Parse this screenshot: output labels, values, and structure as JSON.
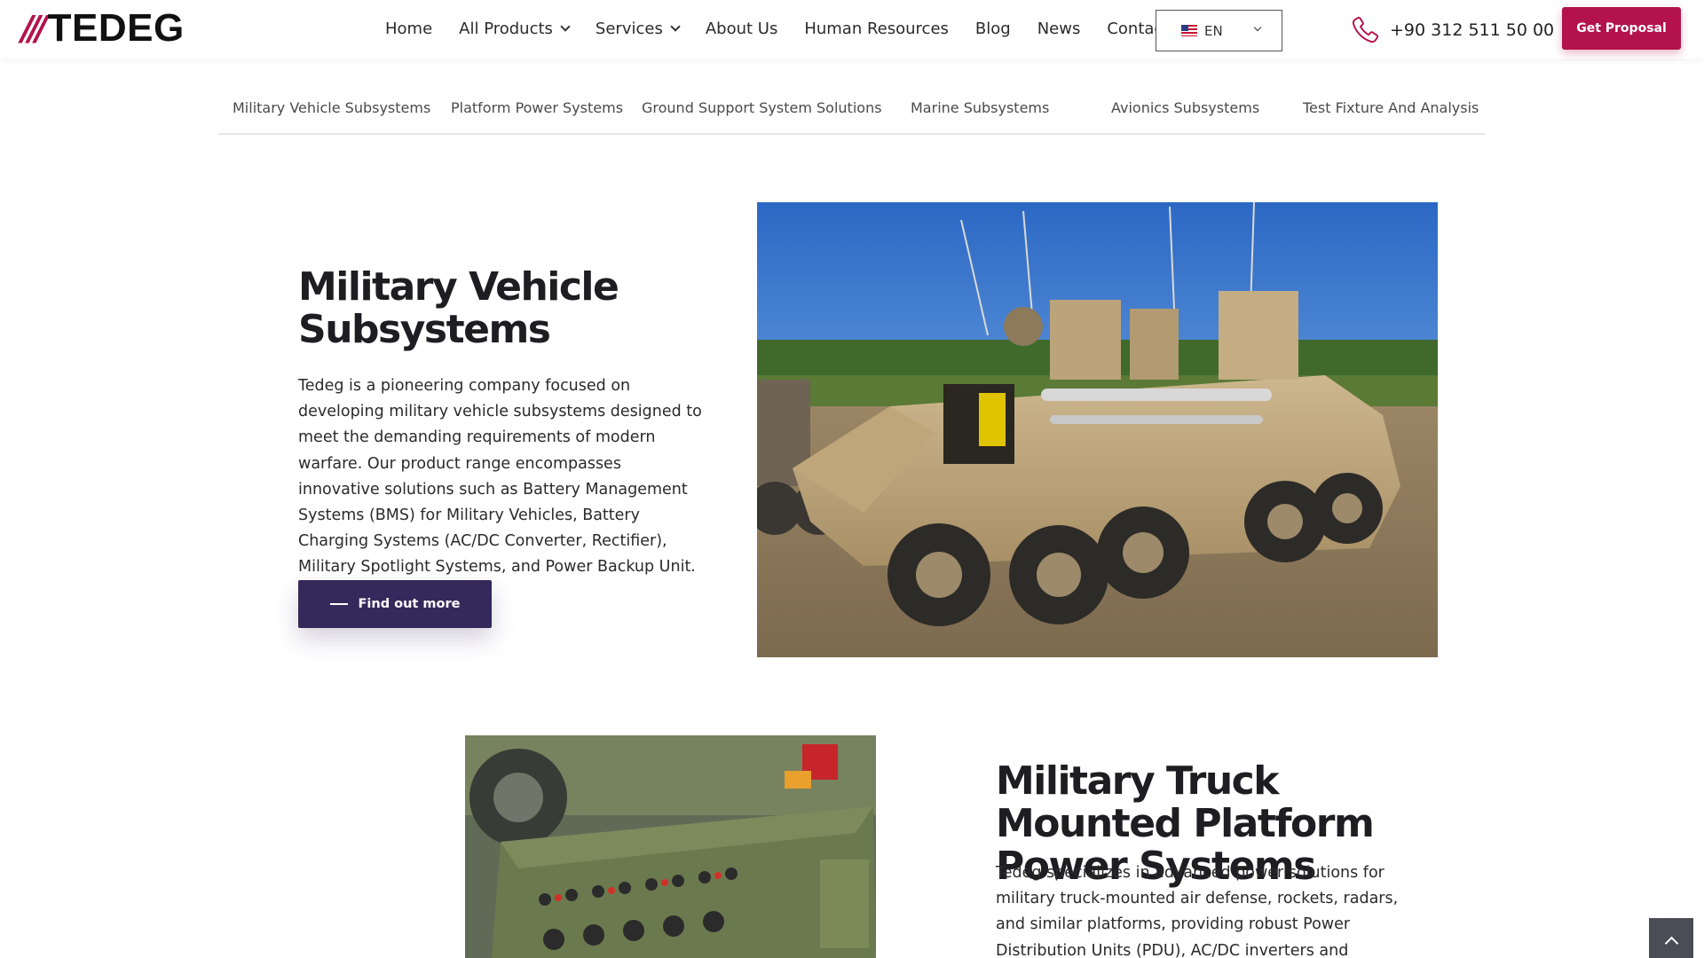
{
  "brand": {
    "slashes": "///",
    "name": "TEDEG"
  },
  "nav": {
    "items": [
      {
        "label": "Home"
      },
      {
        "label": "All Products",
        "dropdown": true
      },
      {
        "label": "Services",
        "dropdown": true
      },
      {
        "label": "About Us"
      },
      {
        "label": "Human Resources"
      },
      {
        "label": "Blog"
      },
      {
        "label": "News"
      },
      {
        "label": "Contact"
      }
    ]
  },
  "language": {
    "selected": "EN",
    "flag": "us-flag-icon"
  },
  "contact": {
    "phone": "+90 312 511 50 00",
    "icon": "phone-icon"
  },
  "cta": {
    "label": "Get Proposal"
  },
  "subnav": {
    "items": [
      "Military Vehicle Subsystems",
      "Platform Power Systems",
      "Ground Support System Solutions",
      "Marine Subsystems",
      "Avionics Subsystems",
      "Test Fixture And Analysis"
    ]
  },
  "section1": {
    "title": "Military Vehicle Subsystems",
    "text": "Tedeg is a pioneering company focused on developing military vehicle subsystems designed to meet the demanding requirements of modern warfare. Our product range encompasses innovative solutions such as Battery Management Systems (BMS) for Military Vehicles, Battery Charging Systems (AC/DC Converter, Rectifier), Military Spotlight Systems, and Power Backup Unit.",
    "button": "Find out more",
    "image": "armored-vehicle-photo"
  },
  "section2": {
    "title": "Military Truck Mounted Platform Power Systems",
    "text": "Tedeg specializes in advanced power solutions for military truck-mounted air defense, rockets, radars, and similar platforms, providing robust Power Distribution Units (PDU), AC/DC inverters and converters, power control systems,",
    "image": "power-distribution-unit-photo"
  },
  "colors": {
    "brand": "#b3124a",
    "button": "#35295b",
    "text": "#1d1d22"
  }
}
